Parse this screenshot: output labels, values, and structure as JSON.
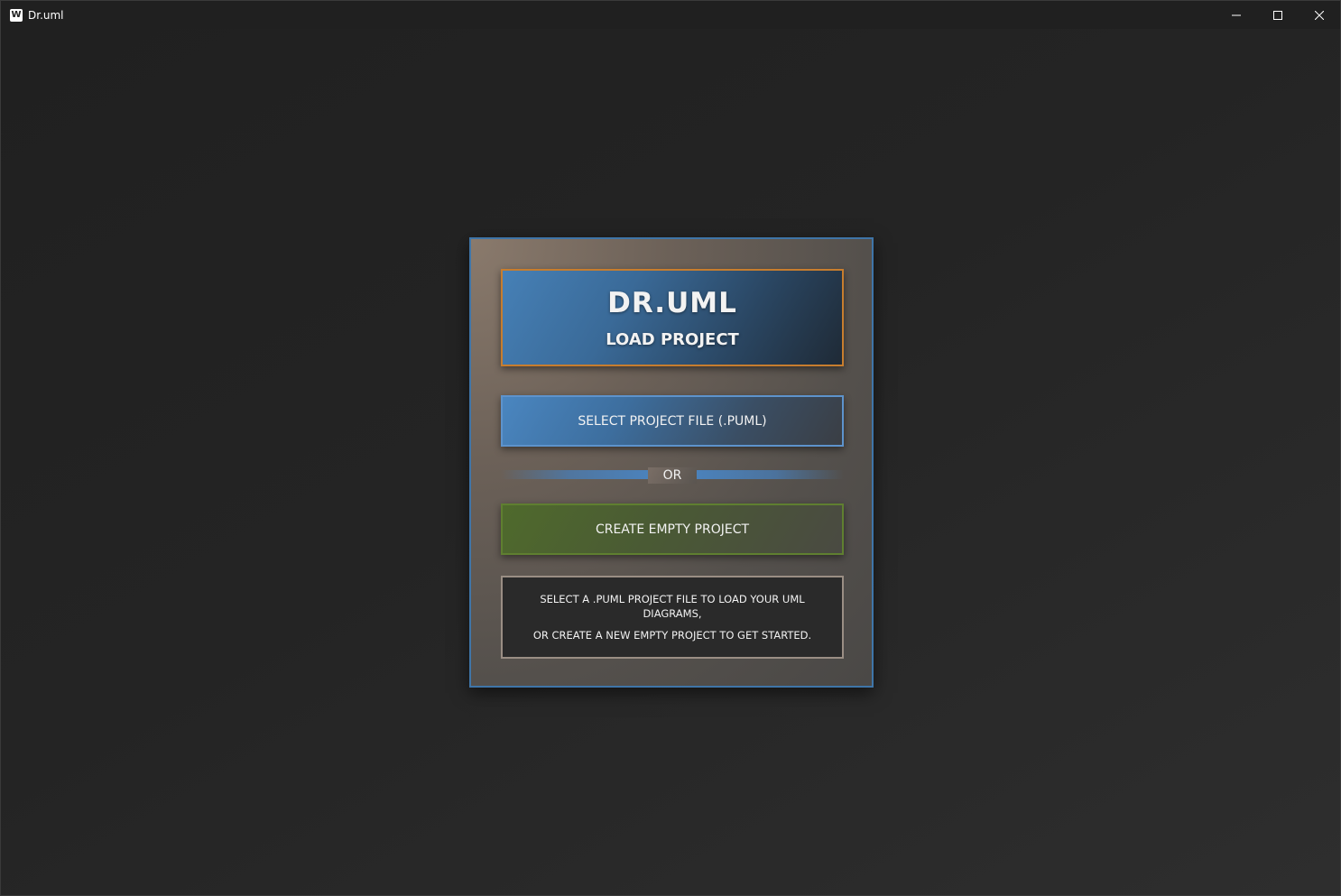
{
  "window": {
    "title": "Dr.uml",
    "icon": "app-w-icon",
    "icon_glyph": "W",
    "controls": [
      "minimize-icon",
      "maximize-icon",
      "close-icon"
    ]
  },
  "panel": {
    "app_name": "DR.UML",
    "subtitle": "LOAD PROJECT",
    "select_button_label": "SELECT PROJECT FILE (.PUML)",
    "divider_label": "OR",
    "create_button_label": "CREATE EMPTY PROJECT",
    "info_line1": "SELECT A .PUML PROJECT FILE TO LOAD YOUR UML DIAGRAMS,",
    "info_line2": "OR CREATE A NEW EMPTY PROJECT TO GET STARTED."
  },
  "colors": {
    "panel_border": "#3f75a8",
    "header_border": "#c77d2e",
    "select_border": "#5d93cc",
    "create_border": "#5f7f30",
    "info_border": "#9a8e84"
  }
}
